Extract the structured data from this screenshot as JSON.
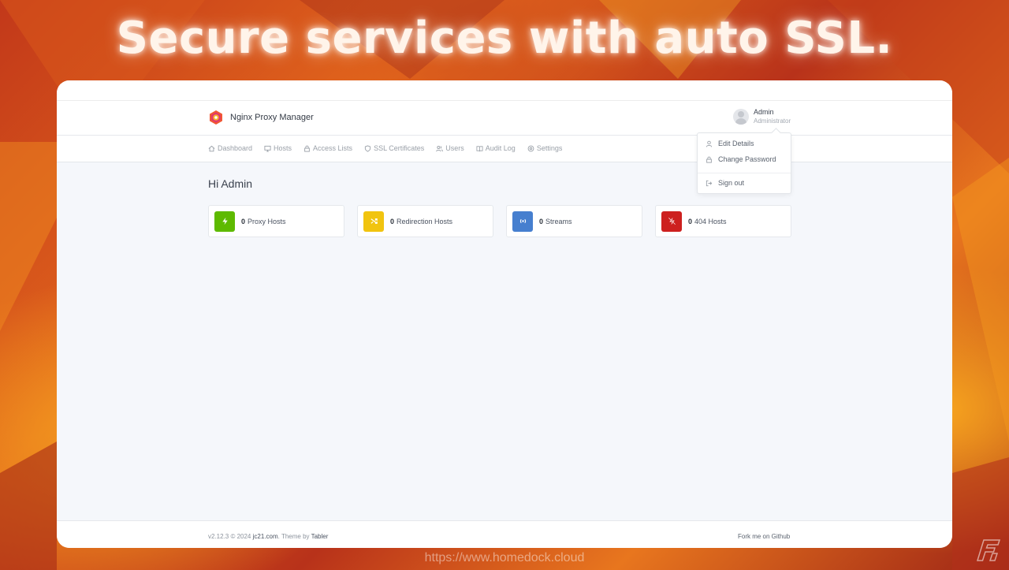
{
  "banner": {
    "text": "Secure services with auto SSL."
  },
  "app": {
    "name": "Nginx Proxy Manager",
    "user": {
      "name": "Admin",
      "role": "Administrator"
    }
  },
  "nav": {
    "items": [
      {
        "label": "Dashboard",
        "icon": "home-icon"
      },
      {
        "label": "Hosts",
        "icon": "monitor-icon"
      },
      {
        "label": "Access Lists",
        "icon": "lock-icon"
      },
      {
        "label": "SSL Certificates",
        "icon": "shield-icon"
      },
      {
        "label": "Users",
        "icon": "users-icon"
      },
      {
        "label": "Audit Log",
        "icon": "book-icon"
      },
      {
        "label": "Settings",
        "icon": "settings-icon"
      }
    ]
  },
  "dropdown": {
    "items": [
      {
        "label": "Edit Details",
        "icon": "user-icon"
      },
      {
        "label": "Change Password",
        "icon": "lock-icon"
      },
      {
        "label": "Sign out",
        "icon": "log-out-icon"
      }
    ]
  },
  "main": {
    "greeting": "Hi Admin",
    "cards": [
      {
        "count": "0",
        "label": "Proxy Hosts",
        "icon": "zap-icon",
        "color": "#5eba00"
      },
      {
        "count": "0",
        "label": "Redirection Hosts",
        "icon": "shuffle-icon",
        "color": "#f1c40f"
      },
      {
        "count": "0",
        "label": "Streams",
        "icon": "radio-icon",
        "color": "#467fcf"
      },
      {
        "count": "0",
        "label": "404 Hosts",
        "icon": "zap-off-icon",
        "color": "#cd201f"
      }
    ]
  },
  "footer": {
    "version": "v2.12.3 © 2024",
    "site": "jc21.com",
    "theme_prefix": ". Theme by",
    "theme": "Tabler",
    "github": "Fork me on Github"
  },
  "watermark": {
    "text": "https://www.homedock.cloud"
  }
}
